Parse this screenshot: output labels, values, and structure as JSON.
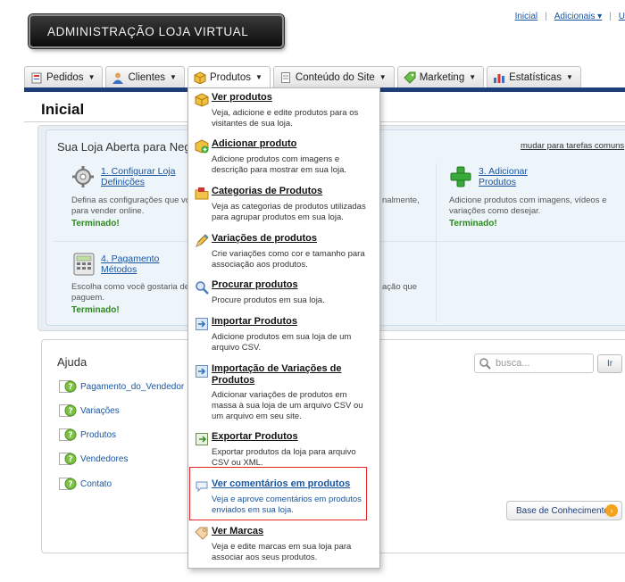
{
  "header": {
    "logo_text": "ADMINISTRAÇÃO  LOJA VIRTUAL",
    "links": [
      "Inicial",
      "Adicionais ▾",
      "U"
    ]
  },
  "tabs": [
    {
      "label": "Pedidos",
      "icon": "orders-icon"
    },
    {
      "label": "Clientes",
      "icon": "customers-icon"
    },
    {
      "label": "Produtos",
      "icon": "products-box-icon"
    },
    {
      "label": "Conteúdo do Site",
      "icon": "page-icon"
    },
    {
      "label": "Marketing",
      "icon": "tag-icon"
    },
    {
      "label": "Estatísticas",
      "icon": "bar-chart-icon"
    }
  ],
  "page": {
    "title": "Inicial",
    "store_title": "Sua Loja Aberta para Neg",
    "change_link": "mudar para tarefas comuns"
  },
  "tasks": [
    {
      "link1": "1. Configurar Loja",
      "link2": "Definições",
      "desc1": "Defina as configurações que vo",
      "desc2": "para vender online.",
      "status": "Terminado!"
    },
    {
      "link1": "3. Adicionar",
      "link2": "Produtos",
      "desc1": "Adicione produtos com imagens, vídeos e",
      "desc2": "variações como desejar.",
      "status": "Terminado!"
    },
    {
      "link1": "4. Pagamento",
      "link2": "Métodos",
      "desc1": "Escolha como você gostaria de",
      "desc2": "paguem.",
      "status": "Terminado!"
    }
  ],
  "task_fragments": [
    "nalmente,",
    "ação que"
  ],
  "help": {
    "title": "Ajuda",
    "items": [
      "Pagamento_do_Vendedor",
      "Variações",
      "Produtos",
      "Vendedores",
      "Contato"
    ],
    "search_placeholder": "busca...",
    "search_button": "Ir",
    "kb_button": "Base de Conhecimento"
  },
  "dropdown": [
    {
      "title": "Ver produtos",
      "desc": "Veja, adicione e edite produtos para os visitantes de sua loja.",
      "icon": "box-icon"
    },
    {
      "title": "Adicionar produto",
      "desc": "Adicione produtos com imagens e descrição para mostrar em sua loja.",
      "icon": "add-box-icon"
    },
    {
      "title": "Categorias de Produtos",
      "desc": "Veja as categorias de produtos utilizadas para agrupar produtos em sua loja.",
      "icon": "folder-icon"
    },
    {
      "title": "Variações de produtos",
      "desc": "Crie variações como cor e tamanho para associação aos produtos.",
      "icon": "pencil-icon"
    },
    {
      "title": "Procurar produtos",
      "desc": "Procure produtos em sua loja.",
      "icon": "magnifier-icon"
    },
    {
      "title": "Importar Produtos",
      "desc": "Adicione produtos em sua loja de um arquivo CSV.",
      "icon": "import-icon"
    },
    {
      "title": "Importação de Variações de Produtos",
      "desc": "Adicionar variações de produtos em massa à sua loja de um arquivo CSV ou um arquivo em seu site.",
      "icon": "import-variations-icon"
    },
    {
      "title": "Exportar Produtos",
      "desc": "Exportar produtos da loja para arquivo CSV ou XML.",
      "icon": "export-icon"
    },
    {
      "title": "Ver comentários em produtos",
      "desc": "Veja e aprove comentários em produtos enviados em sua loja.",
      "icon": "comment-icon"
    },
    {
      "title": "Ver Marcas",
      "desc": "Veja e edite marcas em sua loja para associar aos seus produtos.",
      "icon": "brand-tag-icon"
    }
  ],
  "colors": {
    "nav_bar": "#1d3e78",
    "link": "#1a56a0",
    "done": "#2c8a1e",
    "highlight_border": "#e2262a",
    "help_icon": "#7cc242"
  }
}
